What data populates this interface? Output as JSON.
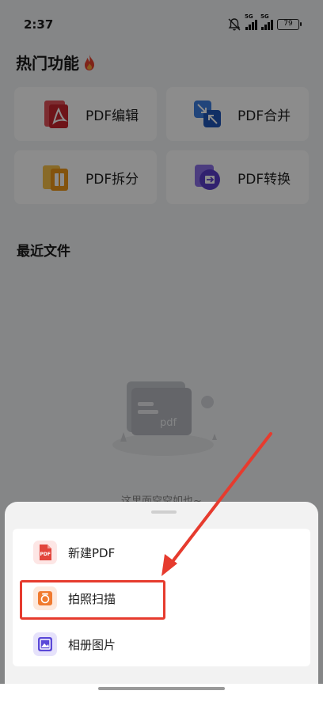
{
  "status_bar": {
    "time": "2:37",
    "network1": "5G",
    "network2": "5G",
    "battery": "79"
  },
  "hot_section": {
    "title": "热门功能",
    "icon": "fire-icon"
  },
  "features": [
    {
      "label": "PDF编辑",
      "icon": "pdf-edit-icon",
      "color": "#d9323b"
    },
    {
      "label": "PDF合并",
      "icon": "pdf-merge-icon",
      "color": "#2f6fd6"
    },
    {
      "label": "PDF拆分",
      "icon": "pdf-split-icon",
      "color": "#f2a21b"
    },
    {
      "label": "PDF转换",
      "icon": "pdf-convert-icon",
      "color": "#6a45d6"
    }
  ],
  "recent": {
    "title": "最近文件",
    "empty_text": "这里面空空如也~",
    "illustration_text": "pdf"
  },
  "sheet": {
    "items": [
      {
        "label": "新建PDF",
        "icon": "new-pdf-icon",
        "icon_text": "PDF",
        "color": "#e2453c"
      },
      {
        "label": "拍照扫描",
        "icon": "camera-scan-icon",
        "color": "#f07a2f"
      },
      {
        "label": "相册图片",
        "icon": "photo-album-icon",
        "color": "#5a48d8"
      }
    ]
  },
  "annotation": {
    "highlight_color": "#e63b2e"
  }
}
